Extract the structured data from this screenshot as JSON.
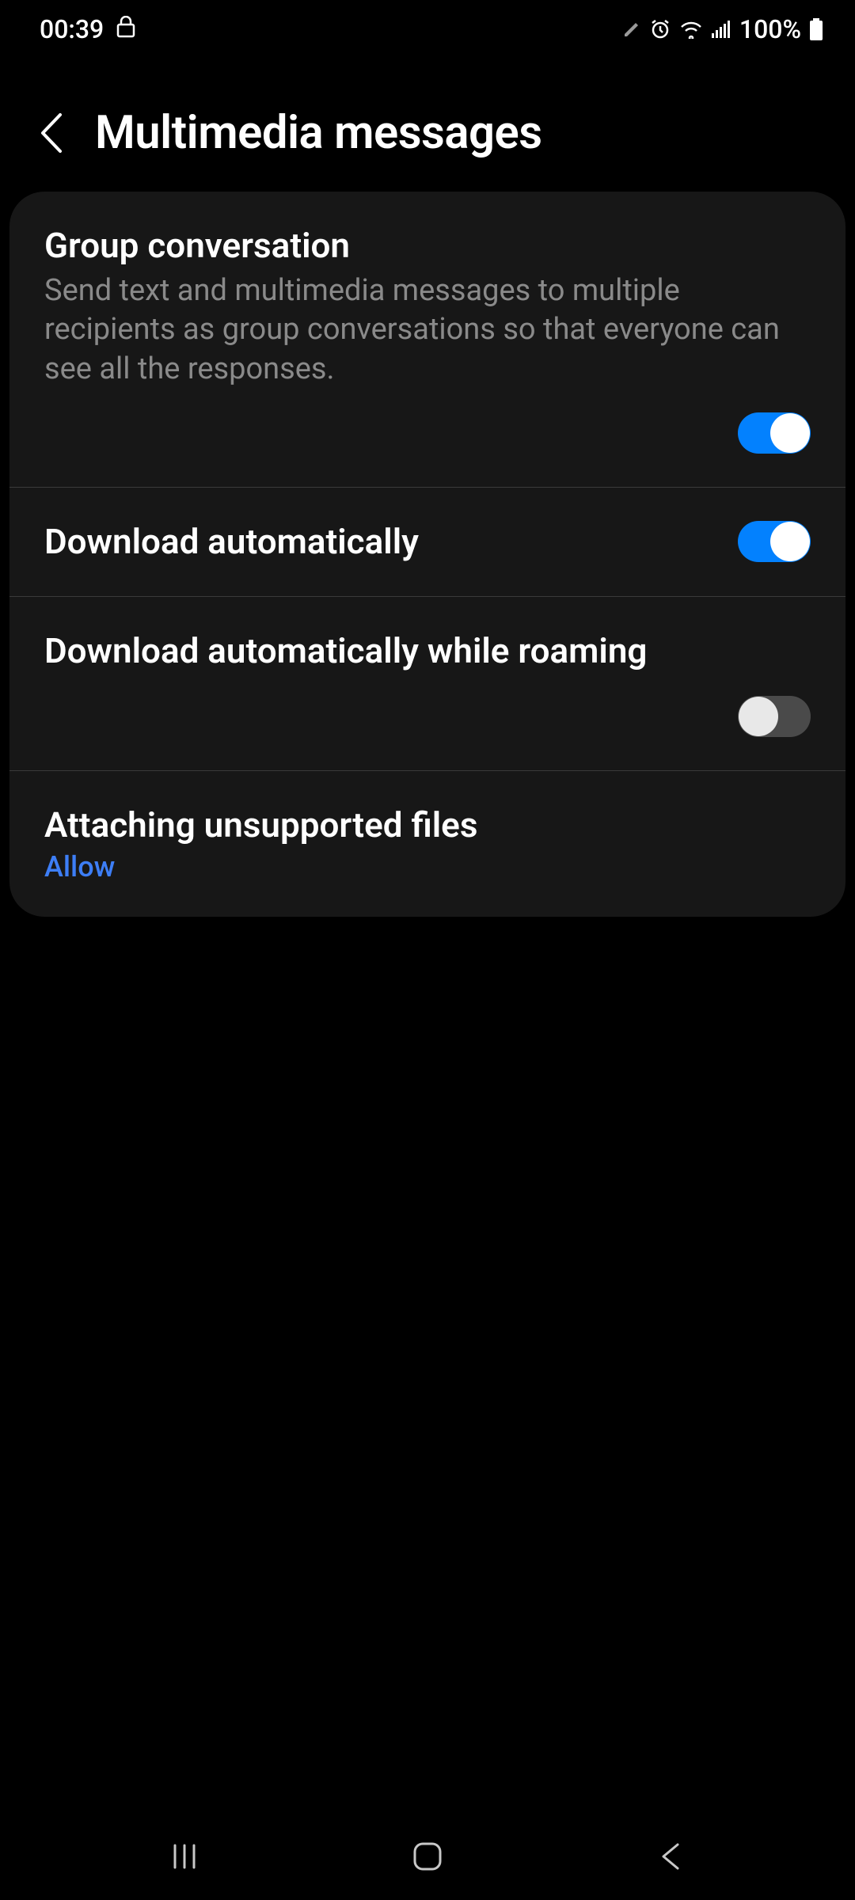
{
  "status": {
    "time": "00:39",
    "battery_text": "100%"
  },
  "header": {
    "title": "Multimedia messages"
  },
  "settings": {
    "group_conversation": {
      "title": "Group conversation",
      "description": "Send text and multimedia messages to multiple recipients as group conversations so that everyone can see all the responses.",
      "enabled": true
    },
    "download_auto": {
      "title": "Download automatically",
      "enabled": true
    },
    "download_roaming": {
      "title": "Download automatically while roaming",
      "enabled": false
    },
    "unsupported_files": {
      "title": "Attaching unsupported files",
      "value": "Allow"
    }
  }
}
